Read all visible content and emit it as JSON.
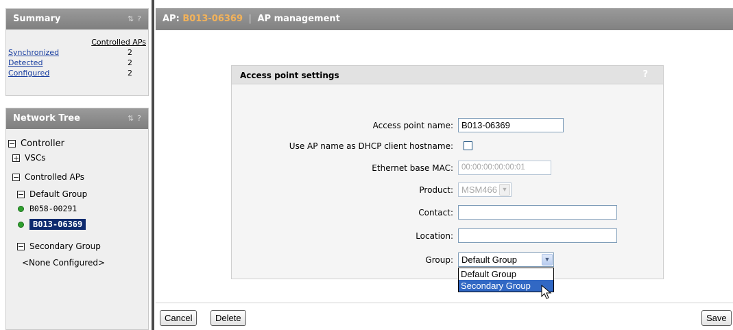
{
  "summary": {
    "title": "Summary",
    "icons": [
      "sync-icon",
      "help-icon"
    ],
    "help": "?",
    "column_header": "Controlled APs",
    "rows": [
      {
        "label": "Synchronized",
        "value": "2"
      },
      {
        "label": "Detected",
        "value": "2"
      },
      {
        "label": "Configured",
        "value": "2"
      }
    ]
  },
  "tree": {
    "title": "Network Tree",
    "help": "?",
    "controller": "Controller",
    "vscs": "VSCs",
    "controlled_aps": "Controlled APs",
    "default_group": "Default Group",
    "ap1": "B058-00291",
    "ap2": "B013-06369",
    "secondary_group": "Secondary Group",
    "none_configured": "<None Configured>"
  },
  "header": {
    "ap_prefix": "AP:",
    "ap_name": "B013-06369",
    "separator": "|",
    "page": "AP management"
  },
  "settings": {
    "title": "Access point settings",
    "help": "?",
    "ap_name_label": "Access point name:",
    "ap_name_value": "B013-06369",
    "dhcp_label": "Use AP name as DHCP client hostname:",
    "dhcp_checked": false,
    "mac_label": "Ethernet base MAC:",
    "mac_value": "00:00:00:00:00:01",
    "product_label": "Product:",
    "product_value": "MSM466",
    "contact_label": "Contact:",
    "contact_value": "",
    "location_label": "Location:",
    "location_value": "",
    "group_label": "Group:",
    "group_value": "Default Group",
    "group_options": [
      "Default Group",
      "Secondary Group"
    ],
    "group_highlighted": "Secondary Group"
  },
  "buttons": {
    "cancel": "Cancel",
    "delete": "Delete",
    "save": "Save"
  },
  "colors": {
    "selected_ap_bg": "#0d2a6e",
    "ap_id_accent": "#f2b25a",
    "status_ok": "#2fa02f",
    "dropdown_highlight": "#3168c4"
  }
}
